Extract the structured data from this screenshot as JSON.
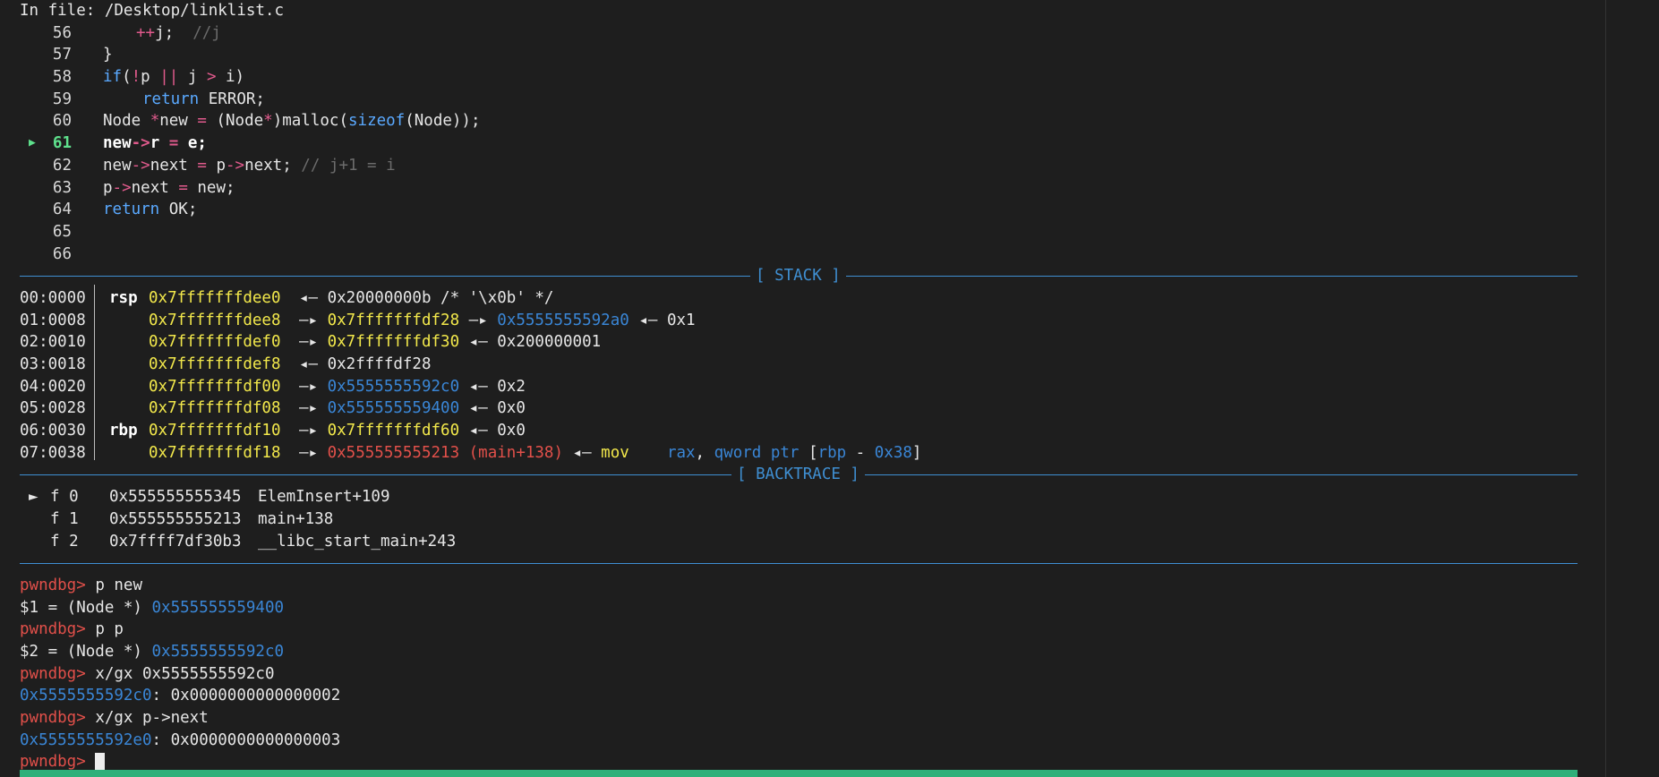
{
  "file_header": "In file: /Desktop/linklist.c",
  "source": {
    "current_line": "61",
    "lines": [
      {
        "n": "56"
      },
      {
        "n": "57"
      },
      {
        "n": "58"
      },
      {
        "n": "59"
      },
      {
        "n": "60"
      },
      {
        "n": "61"
      },
      {
        "n": "62"
      },
      {
        "n": "63"
      },
      {
        "n": "64"
      },
      {
        "n": "65"
      },
      {
        "n": "66"
      }
    ]
  },
  "stack": {
    "banner": "[ STACK ]",
    "rows": [
      {
        "off": "00:0000",
        "reg": "rsp",
        "addr": "0x7fffffffdee0"
      },
      {
        "off": "01:0008",
        "reg": "",
        "addr": "0x7fffffffdee8"
      },
      {
        "off": "02:0010",
        "reg": "",
        "addr": "0x7fffffffdef0"
      },
      {
        "off": "03:0018",
        "reg": "",
        "addr": "0x7fffffffdef8"
      },
      {
        "off": "04:0020",
        "reg": "",
        "addr": "0x7fffffffdf00"
      },
      {
        "off": "05:0028",
        "reg": "",
        "addr": "0x7fffffffdf08"
      },
      {
        "off": "06:0030",
        "reg": "rbp",
        "addr": "0x7fffffffdf10"
      },
      {
        "off": "07:0038",
        "reg": "",
        "addr": "0x7fffffffdf18"
      }
    ]
  },
  "backtrace": {
    "banner": "[ BACKTRACE ]",
    "frames": [
      {
        "marker": "►",
        "frame": "f 0",
        "addr": "0x555555555345",
        "sym": "ElemInsert+109"
      },
      {
        "marker": "",
        "frame": "f 1",
        "addr": "0x555555555213",
        "sym": "main+138"
      },
      {
        "marker": "",
        "frame": "f 2",
        "addr": "0x7ffff7df30b3",
        "sym": "__libc_start_main+243"
      }
    ]
  },
  "console": {
    "prompt": "pwndbg>",
    "cmd1": "p new",
    "res1_prefix": "$1 = (Node *) ",
    "res1_addr": "0x555555559400",
    "cmd2": "p p",
    "res2_prefix": "$2 = (Node *) ",
    "res2_addr": "0x5555555592c0",
    "cmd3": "x/gx 0x5555555592c0",
    "res3_addr": "0x5555555592c0",
    "res3_val": ": 0x0000000000000002",
    "cmd4": "x/gx p->next",
    "res4_addr": "0x5555555592e0",
    "res4_val": ": 0x0000000000000003"
  },
  "colors": {
    "background": "#1e1e1e",
    "address_yellow": "#f2e84b",
    "heap_blue": "#3a86d6",
    "code_red": "#e2504a",
    "banner_blue": "#3f8fd2",
    "status_green": "#2fb07a"
  }
}
